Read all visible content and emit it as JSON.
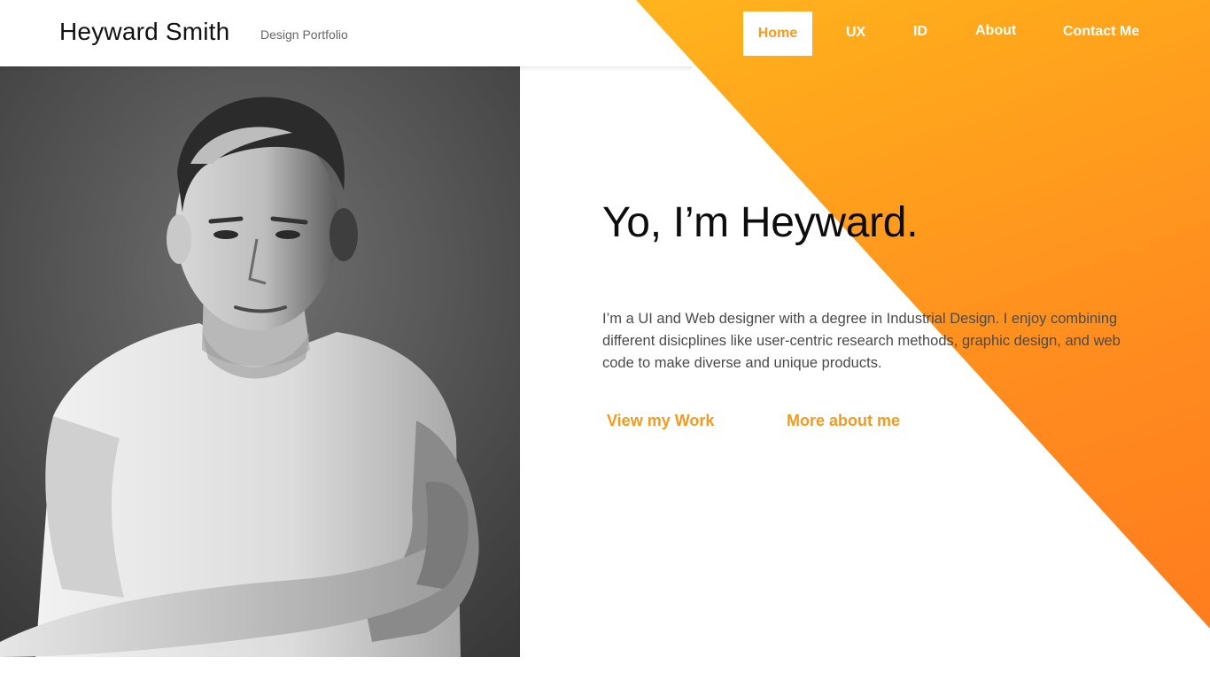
{
  "header": {
    "name": "Heyward Smith",
    "tagline": "Design Portfolio"
  },
  "nav": {
    "items": [
      {
        "label": "Home",
        "active": true
      },
      {
        "label": "UX",
        "active": false
      },
      {
        "label": "ID",
        "active": false
      },
      {
        "label": "About",
        "active": false
      },
      {
        "label": "Contact Me",
        "active": false
      }
    ]
  },
  "hero": {
    "title": "Yo, I’m Heyward.",
    "body": "I’m a UI and Web designer with a degree in Industrial Design. I enjoy combining different disicplines like user-centric research methods, graphic design, and web code to make diverse and unique products.",
    "cta_primary": "View my Work",
    "cta_secondary": "More about me"
  },
  "colors": {
    "accent": "#f39a1f",
    "gradient_start": "#ffc81f",
    "gradient_end": "#ff7a1e"
  }
}
